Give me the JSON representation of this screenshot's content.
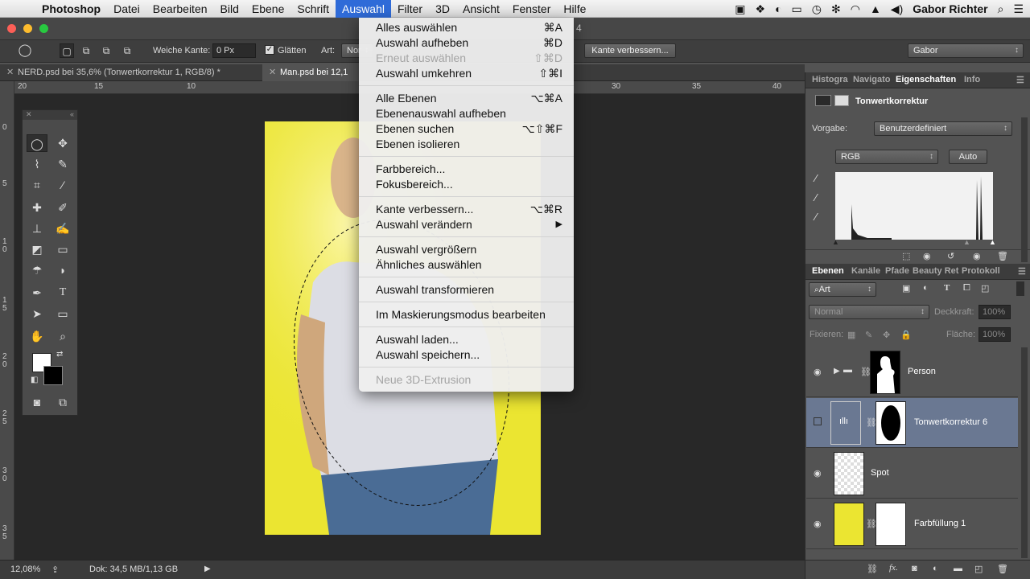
{
  "menubar": {
    "app": "Photoshop",
    "items": [
      "Datei",
      "Bearbeiten",
      "Bild",
      "Ebene",
      "Schrift",
      "Auswahl",
      "Filter",
      "3D",
      "Ansicht",
      "Fenster",
      "Hilfe"
    ],
    "active_index": 5,
    "user": "Gabor Richter"
  },
  "options": {
    "weiche_kante_label": "Weiche Kante:",
    "weiche_kante_value": "0 Px",
    "glaetten_label": "Glätten",
    "art_label": "Art:",
    "art_value": "Nor",
    "refine_button": "Kante verbessern...",
    "workspace": "Gabor",
    "window_title_fragment": "4"
  },
  "tabs": [
    {
      "label": "NERD.psd bei 35,6% (Tonwertkorrektur 1, RGB/8) *",
      "active": false
    },
    {
      "label": "Man.psd bei 12,1",
      "active": true
    }
  ],
  "rulers": {
    "h": [
      "20",
      "15",
      "10",
      "30",
      "35",
      "40"
    ],
    "v": [
      "0",
      "5",
      "1\n0",
      "1\n5",
      "2\n0",
      "2\n5",
      "3\n0",
      "3\n5"
    ]
  },
  "menu": {
    "items": [
      {
        "label": "Alles auswählen",
        "shortcut": "⌘A",
        "disabled": false
      },
      {
        "label": "Auswahl aufheben",
        "shortcut": "⌘D",
        "disabled": false
      },
      {
        "label": "Erneut auswählen",
        "shortcut": "⇧⌘D",
        "disabled": true
      },
      {
        "label": "Auswahl umkehren",
        "shortcut": "⇧⌘I",
        "disabled": false
      },
      {
        "label": "Alle Ebenen",
        "shortcut": "⌥⌘A",
        "disabled": false
      },
      {
        "label": "Ebenenauswahl aufheben",
        "shortcut": "",
        "disabled": false
      },
      {
        "label": "Ebenen suchen",
        "shortcut": "⌥⇧⌘F",
        "disabled": false
      },
      {
        "label": "Ebenen isolieren",
        "shortcut": "",
        "disabled": false
      },
      {
        "label": "Farbbereich...",
        "shortcut": "",
        "disabled": false
      },
      {
        "label": "Fokusbereich...",
        "shortcut": "",
        "disabled": false
      },
      {
        "label": "Kante verbessern...",
        "shortcut": "⌥⌘R",
        "disabled": false
      },
      {
        "label": "Auswahl verändern",
        "shortcut": "▶",
        "disabled": false
      },
      {
        "label": "Auswahl vergrößern",
        "shortcut": "",
        "disabled": false
      },
      {
        "label": "Ähnliches auswählen",
        "shortcut": "",
        "disabled": false
      },
      {
        "label": "Auswahl transformieren",
        "shortcut": "",
        "disabled": false
      },
      {
        "label": "Im Maskierungsmodus bearbeiten",
        "shortcut": "",
        "disabled": false
      },
      {
        "label": "Auswahl laden...",
        "shortcut": "",
        "disabled": false
      },
      {
        "label": "Auswahl speichern...",
        "shortcut": "",
        "disabled": false
      },
      {
        "label": "Neue 3D-Extrusion",
        "shortcut": "",
        "disabled": true
      }
    ]
  },
  "properties": {
    "tabs": [
      "Histogra",
      "Navigato",
      "Eigenschaften",
      "Info"
    ],
    "title": "Tonwertkorrektur",
    "vorgabe_label": "Vorgabe:",
    "vorgabe_value": "Benutzerdefiniert",
    "channel": "RGB",
    "auto": "Auto"
  },
  "layers_panel": {
    "tabs": [
      "Ebenen",
      "Kanäle",
      "Pfade",
      "Beauty Ret",
      "Protokoll"
    ],
    "filter": "Art",
    "blend_mode": "Normal",
    "opacity_label": "Deckkraft:",
    "opacity": "100%",
    "lock_label": "Fixieren:",
    "fill_label": "Fläche:",
    "fill": "100%",
    "layers": [
      {
        "name": "Person",
        "selected": false
      },
      {
        "name": "Tonwertkorrektur 6",
        "selected": true
      },
      {
        "name": "Spot",
        "selected": false
      },
      {
        "name": "Farbfüllung 1",
        "selected": false
      }
    ]
  },
  "status": {
    "zoom": "12,08%",
    "doc": "Dok: 34,5 MB/1,13 GB"
  }
}
